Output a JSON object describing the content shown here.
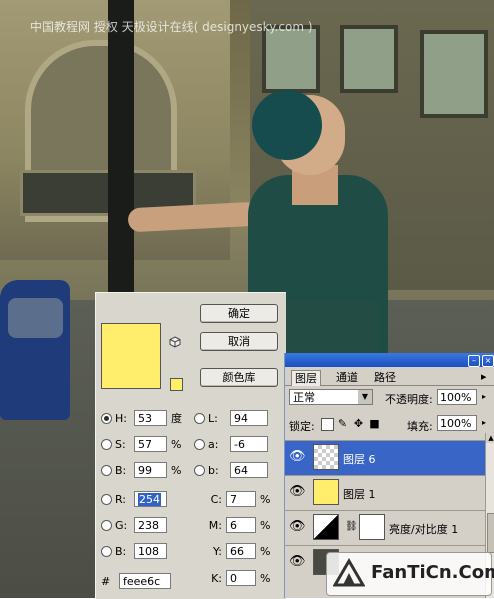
{
  "watermark_top": "中国教程网 授权 天极设计在线( designyesky.com )",
  "color_picker": {
    "buttons": {
      "ok": "确定",
      "cancel": "取消",
      "libraries": "颜色库"
    },
    "current_color": "#feee6c",
    "hsb": {
      "h": {
        "label": "H:",
        "value": "53",
        "unit": "度",
        "selected": true
      },
      "s": {
        "label": "S:",
        "value": "57",
        "unit": "%"
      },
      "b": {
        "label": "B:",
        "value": "99",
        "unit": "%"
      }
    },
    "lab": {
      "l": {
        "label": "L:",
        "value": "94"
      },
      "a": {
        "label": "a:",
        "value": "-6"
      },
      "b": {
        "label": "b:",
        "value": "64"
      }
    },
    "rgb": {
      "r": {
        "label": "R:",
        "value": "254"
      },
      "g": {
        "label": "G:",
        "value": "238"
      },
      "b": {
        "label": "B:",
        "value": "108"
      }
    },
    "cmyk": {
      "c": {
        "label": "C:",
        "value": "7",
        "unit": "%"
      },
      "m": {
        "label": "M:",
        "value": "6",
        "unit": "%"
      },
      "y": {
        "label": "Y:",
        "value": "66",
        "unit": "%"
      },
      "k": {
        "label": "K:",
        "value": "0",
        "unit": "%"
      }
    },
    "hex": {
      "label": "#",
      "value": "feee6c"
    }
  },
  "layers_panel": {
    "tabs": [
      "图层",
      "通道",
      "路径"
    ],
    "active_tab": "图层",
    "blend_mode": "正常",
    "opacity_label": "不透明度:",
    "opacity_value": "100%",
    "lock_label": "锁定:",
    "fill_label": "填充:",
    "fill_value": "100%",
    "layers": [
      {
        "name": "图层 6",
        "thumb": "transparent",
        "active": true
      },
      {
        "name": "图层 1",
        "thumb": "yellow",
        "active": false
      },
      {
        "name": "亮度/对比度 1",
        "thumb": "adjustment",
        "active": false
      }
    ]
  },
  "watermark_logo": "FanTiCn.Com"
}
